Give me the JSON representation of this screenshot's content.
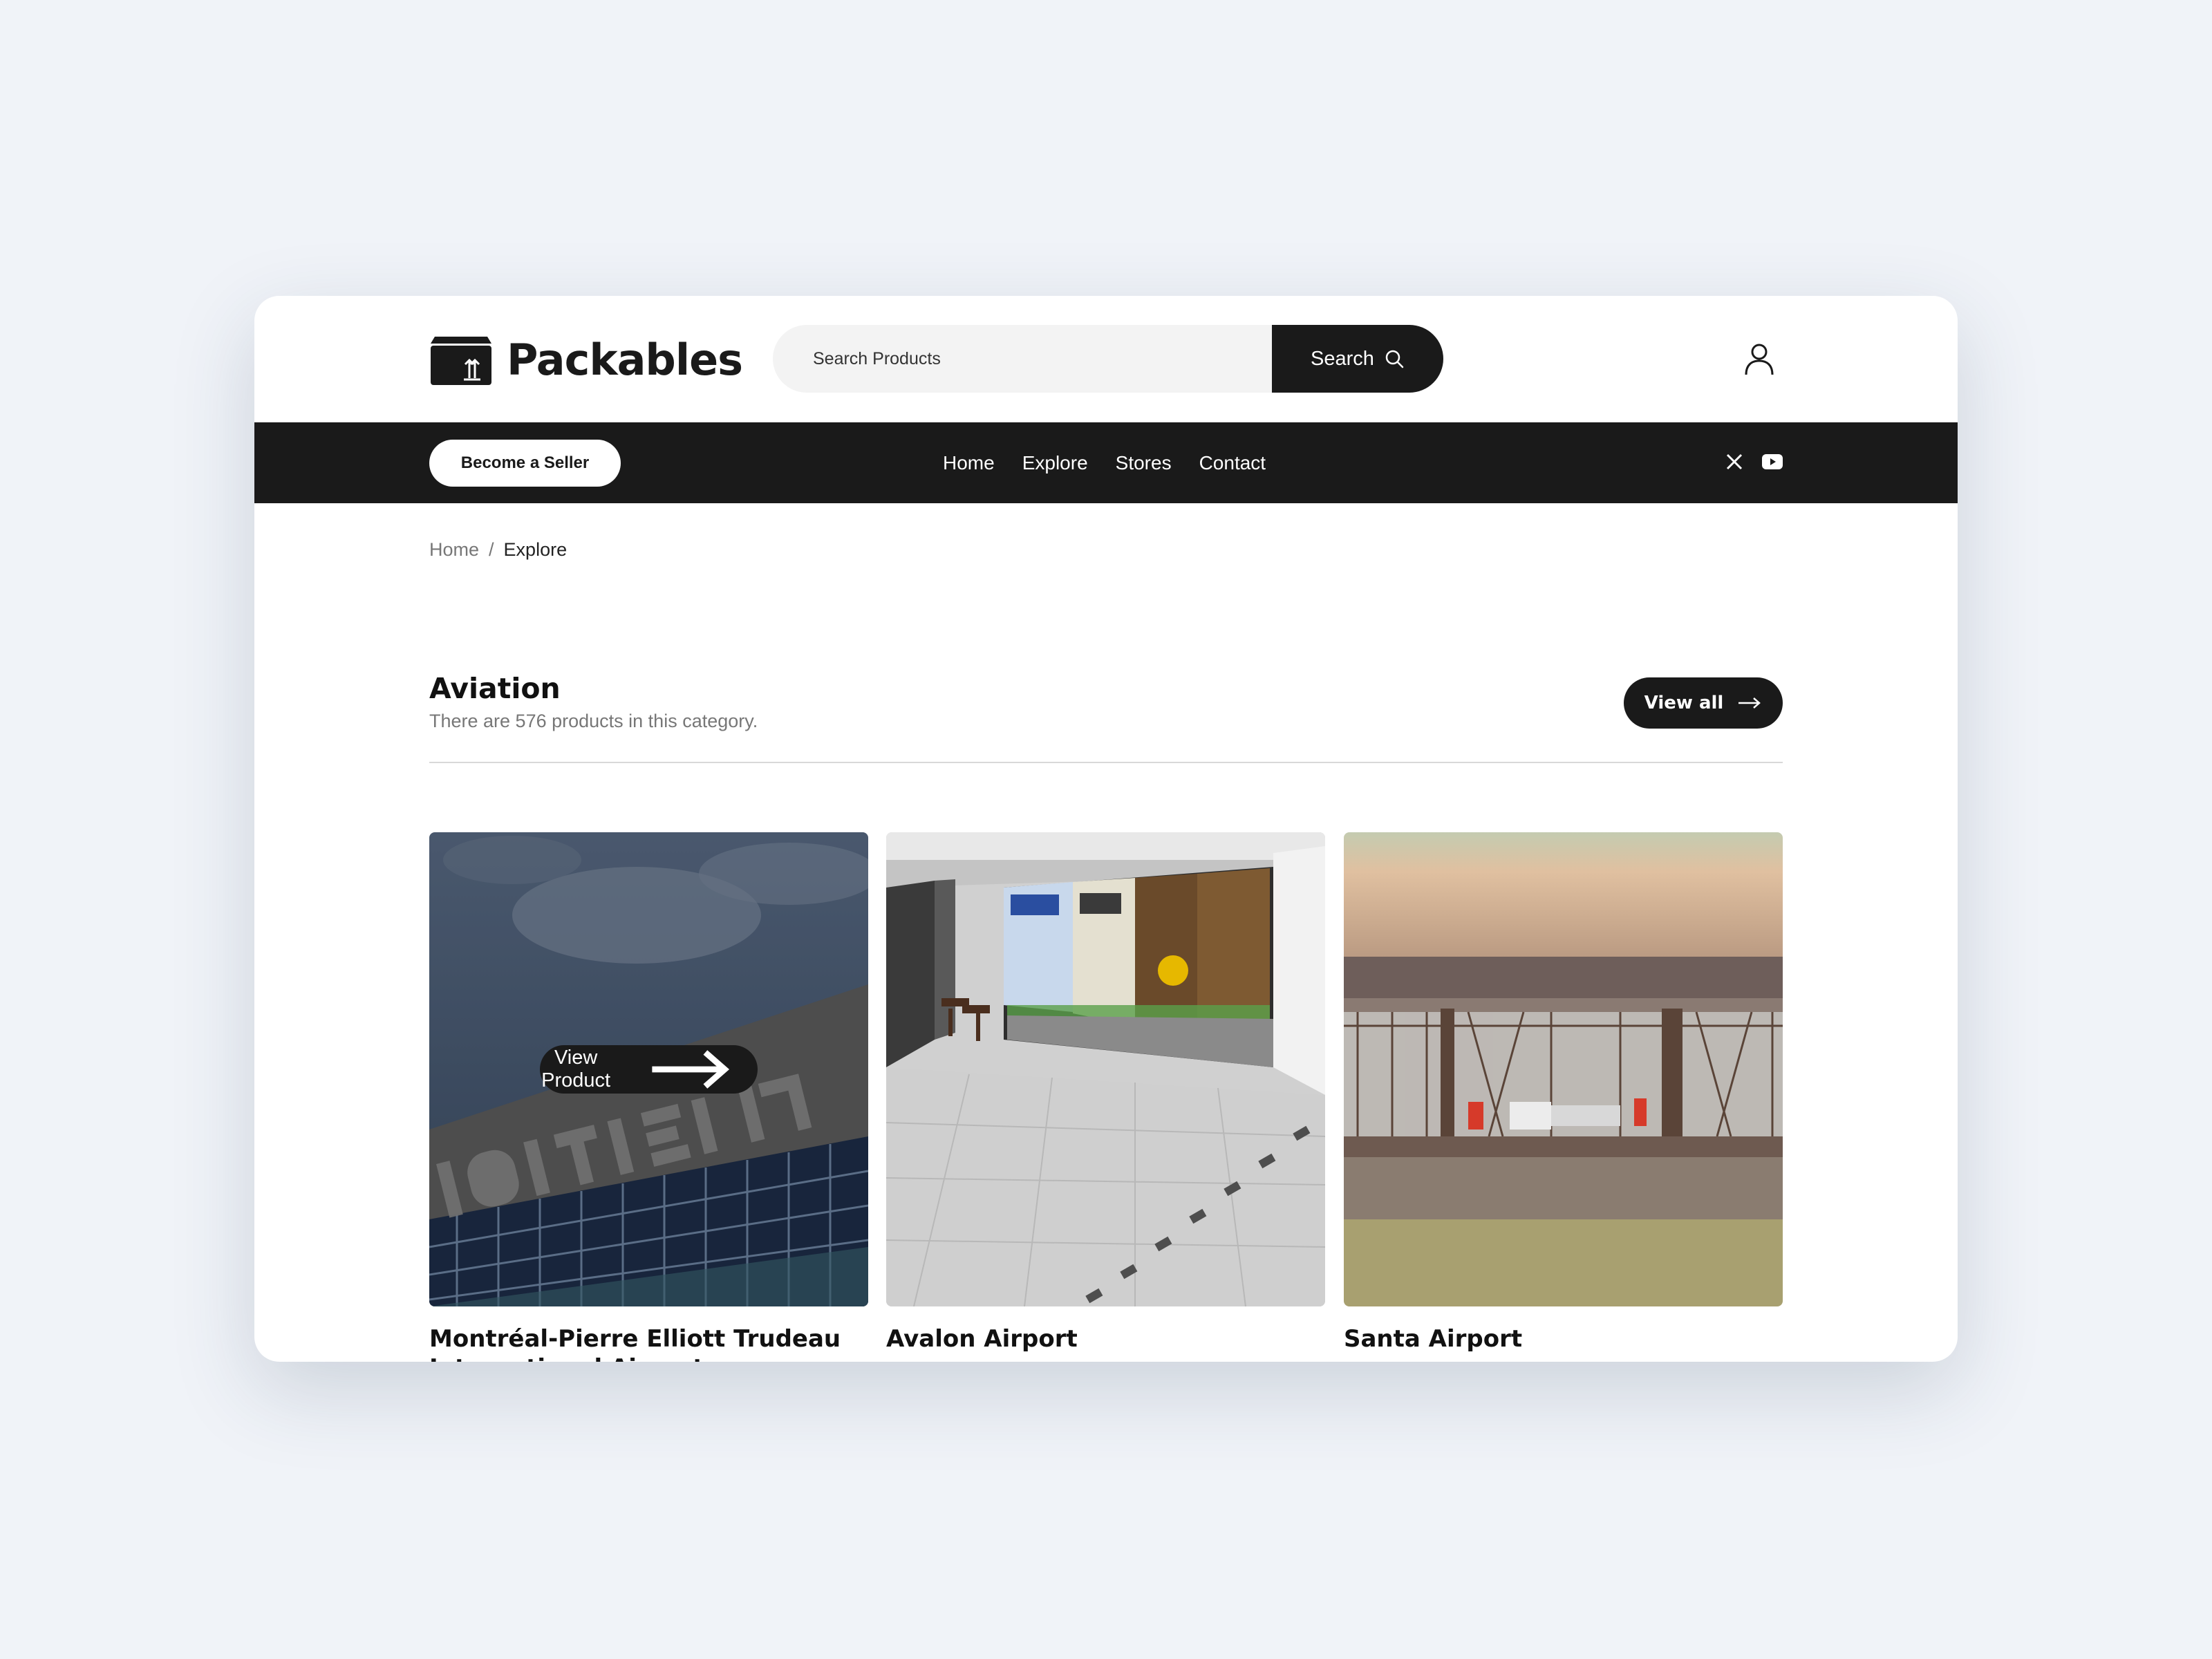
{
  "brand": {
    "name": "Packables"
  },
  "search": {
    "placeholder": "Search Products",
    "button_label": "Search"
  },
  "navbar": {
    "seller_button": "Become a Seller",
    "links": [
      "Home",
      "Explore",
      "Stores",
      "Contact"
    ],
    "social": [
      "x-icon",
      "youtube-icon"
    ]
  },
  "breadcrumb": {
    "home": "Home",
    "separator": "/",
    "current": "Explore"
  },
  "category": {
    "title": "Aviation",
    "subtitle": "There are 576 products in this category.",
    "view_all_label": "View all"
  },
  "products": [
    {
      "title": "Montréal-Pierre Elliott Trudeau International Airport",
      "overlay_label": "View Product",
      "image_icon": "montreal-airport-thumbnail"
    },
    {
      "title": "Avalon Airport",
      "image_icon": "avalon-airport-thumbnail"
    },
    {
      "title": "Santa Airport",
      "image_icon": "santa-airport-thumbnail"
    }
  ],
  "colors": {
    "dark": "#1a1a1a",
    "background": "#f0f3f8",
    "card": "#ffffff"
  }
}
